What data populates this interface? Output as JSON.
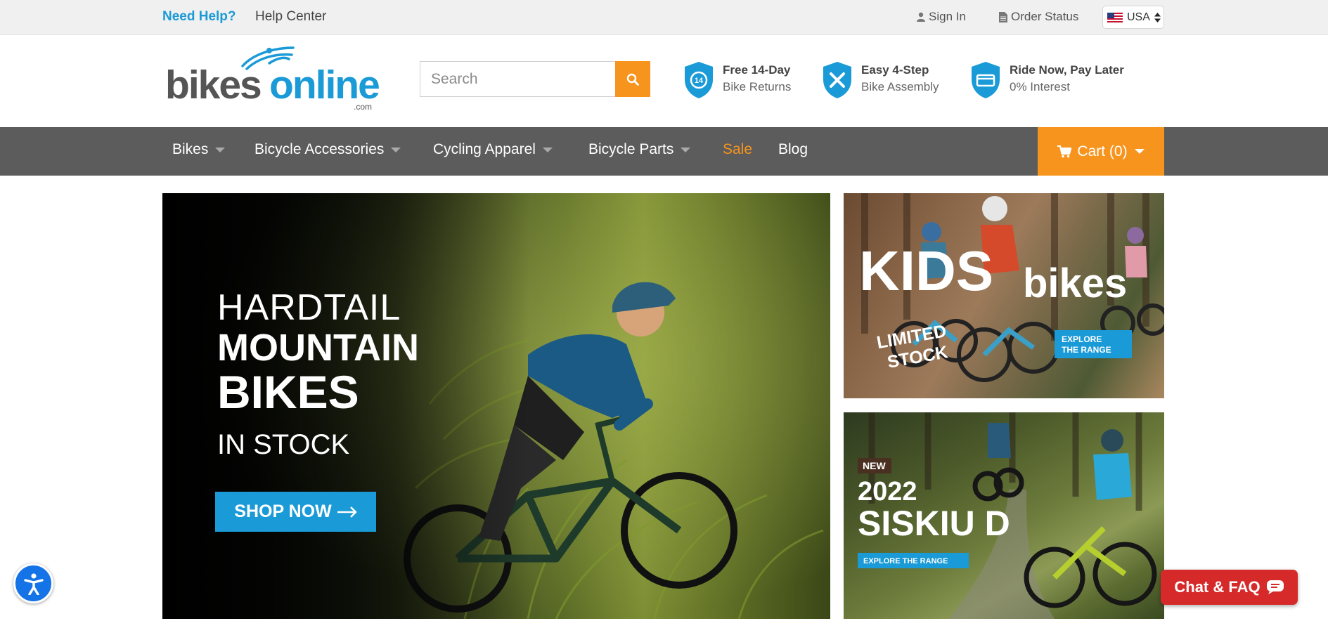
{
  "topbar": {
    "need_help": "Need Help?",
    "help_center": "Help Center",
    "sign_in": "Sign In",
    "order_status": "Order Status",
    "country": "USA"
  },
  "header": {
    "logo": {
      "part1": "bikes",
      "part2": "online",
      "suffix": ".com"
    },
    "search_placeholder": "Search",
    "features": [
      {
        "title": "Free 14-Day",
        "subtitle": "Bike Returns",
        "icon": "returns-shield-icon",
        "badge": "14"
      },
      {
        "title": "Easy 4-Step",
        "subtitle": "Bike Assembly",
        "icon": "tools-shield-icon"
      },
      {
        "title": "Ride Now, Pay Later",
        "subtitle": "0% Interest",
        "icon": "payment-shield-icon"
      }
    ]
  },
  "nav": {
    "items": [
      {
        "label": "Bikes"
      },
      {
        "label": "Bicycle Accessories"
      },
      {
        "label": "Cycling Apparel"
      },
      {
        "label": "Bicycle Parts"
      },
      {
        "label": "Sale"
      },
      {
        "label": "Blog"
      }
    ],
    "cart_label": "Cart (0)"
  },
  "hero": {
    "line1": "HARDTAIL",
    "line2": "MOUNTAIN",
    "line3": "BIKES",
    "line4": "IN STOCK",
    "cta": "SHOP NOW"
  },
  "promo_kids": {
    "title1": "KIDS",
    "title2": "bikes",
    "badge1": "LIMITED",
    "badge2": "STOCK",
    "cta1": "EXPLORE",
    "cta2": "THE RANGE"
  },
  "promo_siskiu": {
    "tag": "NEW",
    "year": "2022",
    "model": "SISKIU D",
    "cta": "EXPLORE THE RANGE"
  },
  "widgets": {
    "chat_label": "Chat & FAQ"
  },
  "colors": {
    "brand_blue": "#1a9ad6",
    "brand_orange": "#f7941d",
    "nav_gray": "#5c5c5c",
    "chat_red": "#d62a2a"
  }
}
